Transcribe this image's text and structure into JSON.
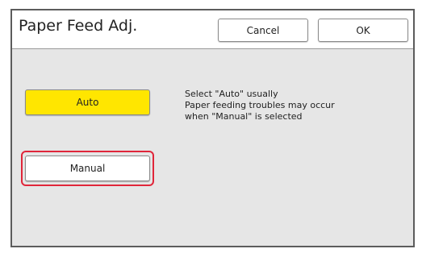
{
  "header": {
    "title": "Paper Feed Adj.",
    "cancel_label": "Cancel",
    "ok_label": "OK"
  },
  "options": {
    "auto_label": "Auto",
    "manual_label": "Manual",
    "selected": "Auto",
    "highlighted": "Manual"
  },
  "description": {
    "line1": "Select \"Auto\" usually",
    "line2": "Paper feeding troubles may occur",
    "line3": "when \"Manual\" is selected"
  },
  "colors": {
    "selected_button": "#ffe600",
    "highlight_outline": "#e0263a",
    "panel_background": "#e6e6e6"
  }
}
